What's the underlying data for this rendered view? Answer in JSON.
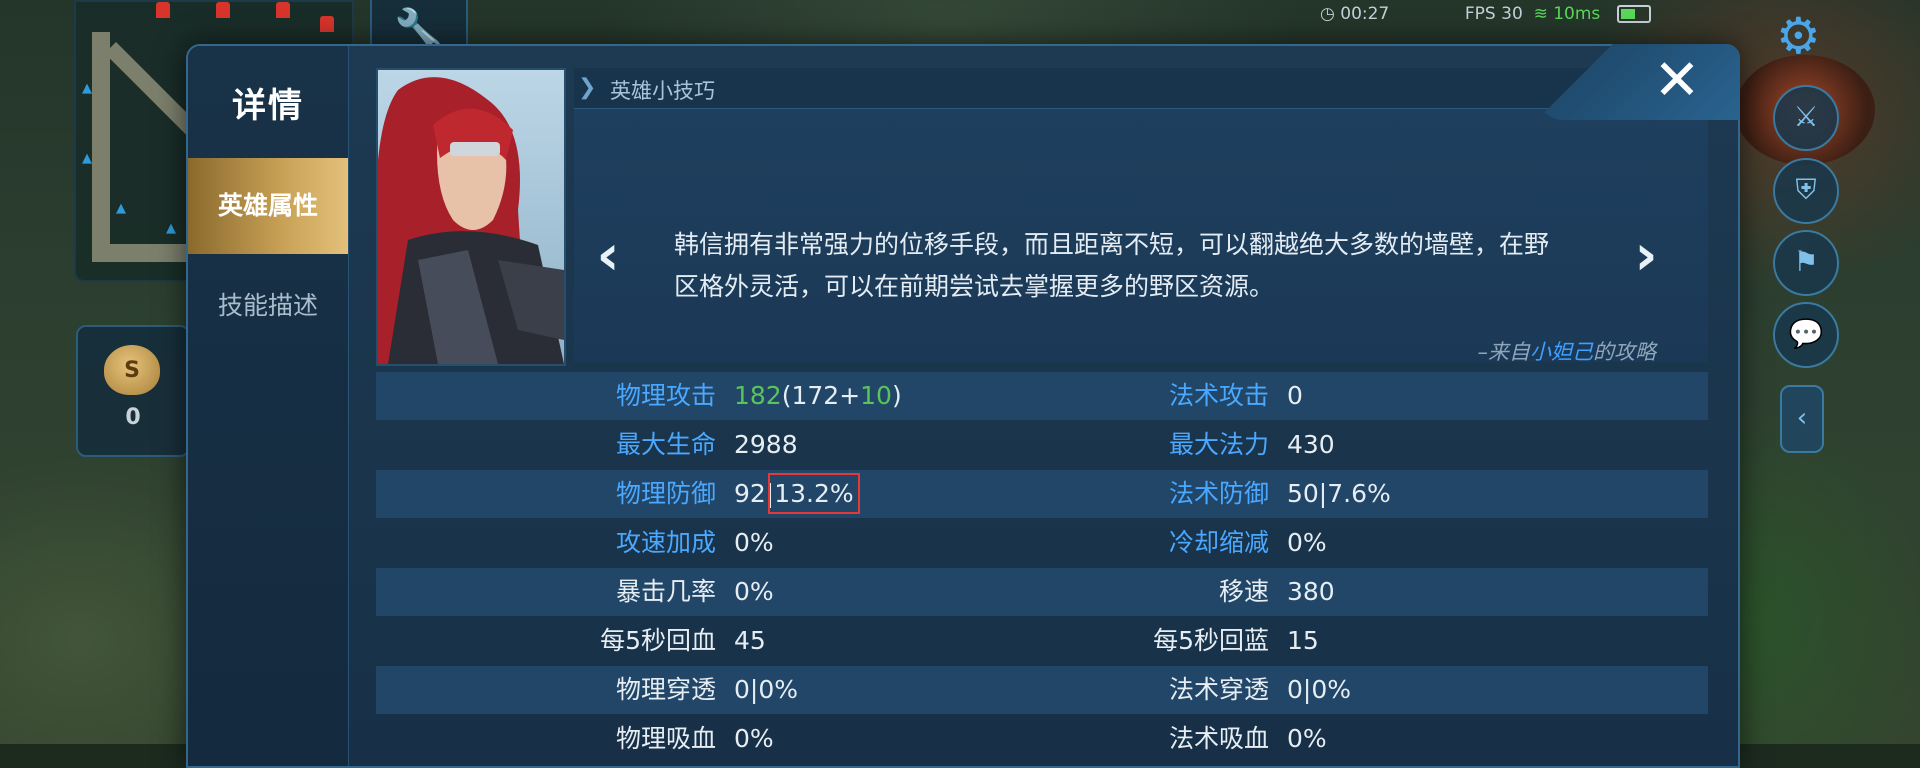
{
  "hud": {
    "timer": "00:27",
    "fps": "FPS 30",
    "ping": "10ms",
    "gold": "0"
  },
  "dialog": {
    "title": "详情",
    "tabs": [
      {
        "label": "英雄属性",
        "active": true
      },
      {
        "label": "技能描述",
        "active": false
      }
    ],
    "close_label": "✕",
    "tips": {
      "title": "英雄小技巧",
      "text": "韩信拥有非常强力的位移手段，而且距离不短，可以翻越绝大多数的墙壁，在野区格外灵活，可以在前期尝试去掌握更多的野区资源。",
      "source_prefix": "–来自",
      "source_author": "小妲己",
      "source_suffix": "的攻略"
    },
    "stats": [
      {
        "left": {
          "label": "物理攻击",
          "total": "182",
          "open": "(172+",
          "bonus": "10",
          "close": ")"
        },
        "right": {
          "label": "法术攻击",
          "value": "0"
        }
      },
      {
        "left": {
          "label": "最大生命",
          "value": "2988"
        },
        "right": {
          "label": "最大法力",
          "value": "430"
        }
      },
      {
        "left": {
          "label": "物理防御",
          "value": "92|",
          "highlight": "13.2%"
        },
        "right": {
          "label": "法术防御",
          "value": "50|7.6%"
        }
      },
      {
        "left": {
          "label": "攻速加成",
          "value": "0%"
        },
        "right": {
          "label": "冷却缩减",
          "value": "0%"
        }
      },
      {
        "left": {
          "label": "暴击几率",
          "value": "0%"
        },
        "right": {
          "label": "移速",
          "value": "380"
        }
      },
      {
        "left": {
          "label": "每5秒回血",
          "value": "45"
        },
        "right": {
          "label": "每5秒回蓝",
          "value": "15"
        }
      },
      {
        "left": {
          "label": "物理穿透",
          "value": "0|0%"
        },
        "right": {
          "label": "法术穿透",
          "value": "0|0%"
        }
      },
      {
        "left": {
          "label": "物理吸血",
          "value": "0%"
        },
        "right": {
          "label": "法术吸血",
          "value": "0%"
        }
      }
    ]
  },
  "colors": {
    "stat_label_blue": "#4aa8ff",
    "bonus_green": "#59c45a",
    "active_tab_gold": "#c9a257",
    "highlight_box": "#e53935"
  }
}
